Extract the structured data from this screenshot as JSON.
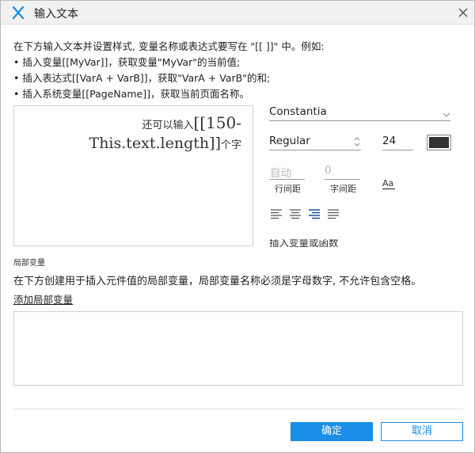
{
  "dialog": {
    "title": "输入文本",
    "colors": {
      "accent": "#1a8ee6",
      "titlebar_bg": "#f1f1f1",
      "logo": "#1a8ee6"
    }
  },
  "instructions": [
    "在下方输入文本并设置样式, 变量名称或表达式要写在 \"[[ ]]\" 中。例如:",
    "• 插入变量[[MyVar]]，获取变量\"MyVar\"的当前值;",
    "• 插入表达式[[VarA + VarB]]，获取\"VarA + VarB\"的和;",
    "• 插入系统变量[[PageName]]，获取当前页面名称。"
  ],
  "editor": {
    "line1_prefix": "还可以输入",
    "line1_expr": "[[150-",
    "line2_expr": "This.text.length]]",
    "line2_suffix": "个字"
  },
  "style_panel": {
    "font_family": "Constantia",
    "font_style": "Regular",
    "font_size": "24",
    "font_color": "#333333",
    "line_spacing": {
      "value": "自动",
      "label": "行间距"
    },
    "char_spacing": {
      "value": "0",
      "label": "字间距"
    },
    "text_style_icon": "text-style-icon",
    "align_icons": [
      "align-left-icon",
      "align-center-icon",
      "align-right-icon",
      "align-justify-icon"
    ],
    "selected_align": "align-right-icon",
    "clipped_text": "插入变量或函数"
  },
  "local_vars": {
    "section_label": "局部变量",
    "description": "在下方创建用于插入元件值的局部变量，局部变量名称必须是字母数字, 不允许包含空格。",
    "add_link": "添加局部变量"
  },
  "buttons": {
    "ok": "确定",
    "cancel": "取消"
  }
}
